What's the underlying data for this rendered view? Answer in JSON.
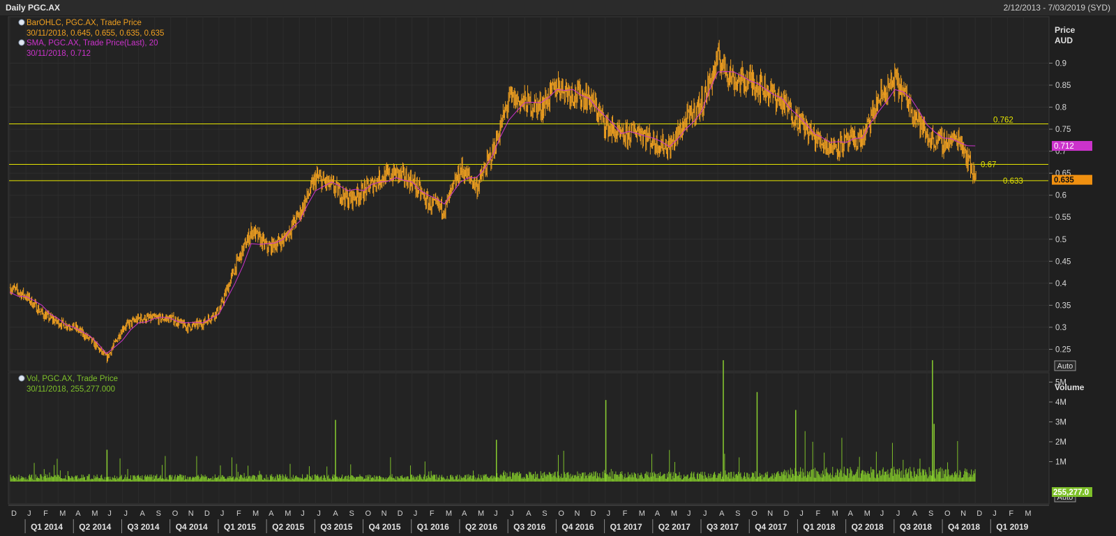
{
  "window": {
    "title": "Daily PGC.AX",
    "date_range": "2/12/2013 - 7/03/2019 (SYD)"
  },
  "colors": {
    "background": "#1f1f1f",
    "grid": "#303030",
    "price": "#f0a020",
    "sma": "#cc33cc",
    "volume": "#7ec02a",
    "level_line": "#e6e600",
    "axis_text": "#d8d8d8"
  },
  "price_panel": {
    "legend": [
      {
        "icon": "eye-icon",
        "text": "BarOHLC, PGC.AX, Trade Price",
        "color": "#f0a020"
      },
      {
        "icon": "",
        "text": "30/11/2018, 0.645, 0.655, 0.635, 0.635",
        "color": "#f0a020"
      },
      {
        "icon": "eye-icon",
        "text": "SMA, PGC.AX, Trade Price(Last),  20",
        "color": "#cc33cc"
      },
      {
        "icon": "",
        "text": "30/11/2018, 0.712",
        "color": "#cc33cc"
      }
    ],
    "axis_title": "Price",
    "axis_unit": "AUD",
    "auto_label": "Auto",
    "sma_tag": "0.712",
    "last_tag": "0.635",
    "level_labels": [
      "0.762",
      "0.67",
      "0.633"
    ]
  },
  "volume_panel": {
    "legend": [
      {
        "icon": "eye-icon",
        "text": "Vol, PGC.AX, Trade Price",
        "color": "#7ec02a"
      },
      {
        "icon": "",
        "text": "30/11/2018, 255,277.000",
        "color": "#7ec02a"
      }
    ],
    "axis_title": "Volume",
    "auto_label": "Auto",
    "last_tag": "255,277.0"
  },
  "chart_data": {
    "type": "line",
    "title": "Daily PGC.AX",
    "series_ohlc": "BarOHLC, PGC.AX, Trade Price",
    "series_sma": "SMA, PGC.AX, Trade Price(Last),  20",
    "series_volume": "Vol, PGC.AX, Trade Price",
    "ylabel": "Price AUD",
    "ylim": [
      0.2,
      0.98
    ],
    "yticks": [
      "0.25",
      "0.3",
      "0.35",
      "0.4",
      "0.45",
      "0.5",
      "0.55",
      "0.6",
      "0.65",
      "0.7",
      "0.75",
      "0.8",
      "0.85",
      "0.9"
    ],
    "volume_ylim": [
      0,
      6000000
    ],
    "volume_ticks": [
      "1M",
      "2M",
      "3M",
      "4M",
      "5M"
    ],
    "horizontal_levels": [
      0.762,
      0.67,
      0.633
    ],
    "last_bar": {
      "date": "30/11/2018",
      "open": 0.645,
      "high": 0.655,
      "low": 0.635,
      "close": 0.635
    },
    "last_sma": 0.712,
    "last_volume": 255277,
    "month_labels": [
      "D",
      "J",
      "F",
      "M",
      "A",
      "M",
      "J",
      "J",
      "A",
      "S",
      "O",
      "N",
      "D",
      "J",
      "F",
      "M",
      "A",
      "M",
      "J",
      "J",
      "A",
      "S",
      "O",
      "N",
      "D",
      "J",
      "F",
      "M",
      "A",
      "M",
      "J",
      "J",
      "A",
      "S",
      "O",
      "N",
      "D",
      "J",
      "F",
      "M",
      "A",
      "M",
      "J",
      "J",
      "A",
      "S",
      "O",
      "N",
      "D",
      "J",
      "F",
      "M",
      "A",
      "M",
      "J",
      "J",
      "A",
      "S",
      "O",
      "N",
      "D",
      "J",
      "F",
      "M"
    ],
    "quarter_labels": [
      "Q1 2014",
      "Q2 2014",
      "Q3 2014",
      "Q4 2014",
      "Q1 2015",
      "Q2 2015",
      "Q3 2015",
      "Q4 2015",
      "Q1 2016",
      "Q2 2016",
      "Q3 2016",
      "Q4 2016",
      "Q1 2017",
      "Q2 2017",
      "Q3 2017",
      "Q4 2017",
      "Q1 2018",
      "Q2 2018",
      "Q3 2018",
      "Q4 2018",
      "Q1 2019"
    ],
    "close_monthly": [
      0.39,
      0.37,
      0.33,
      0.31,
      0.3,
      0.27,
      0.23,
      0.3,
      0.32,
      0.32,
      0.32,
      0.3,
      0.31,
      0.34,
      0.44,
      0.52,
      0.48,
      0.5,
      0.56,
      0.64,
      0.62,
      0.59,
      0.61,
      0.64,
      0.65,
      0.63,
      0.58,
      0.57,
      0.66,
      0.62,
      0.7,
      0.82,
      0.81,
      0.8,
      0.85,
      0.83,
      0.82,
      0.76,
      0.73,
      0.75,
      0.72,
      0.71,
      0.77,
      0.81,
      0.91,
      0.86,
      0.86,
      0.84,
      0.81,
      0.77,
      0.73,
      0.71,
      0.72,
      0.73,
      0.82,
      0.86,
      0.8,
      0.73,
      0.72,
      0.73,
      0.635
    ],
    "sma_monthly": [
      0.38,
      0.37,
      0.35,
      0.32,
      0.3,
      0.28,
      0.24,
      0.27,
      0.31,
      0.32,
      0.32,
      0.31,
      0.31,
      0.33,
      0.4,
      0.49,
      0.49,
      0.5,
      0.54,
      0.61,
      0.63,
      0.61,
      0.61,
      0.63,
      0.64,
      0.63,
      0.6,
      0.58,
      0.63,
      0.64,
      0.69,
      0.77,
      0.81,
      0.81,
      0.84,
      0.84,
      0.82,
      0.78,
      0.74,
      0.74,
      0.73,
      0.71,
      0.75,
      0.79,
      0.88,
      0.88,
      0.86,
      0.84,
      0.82,
      0.78,
      0.74,
      0.72,
      0.72,
      0.73,
      0.79,
      0.84,
      0.82,
      0.76,
      0.73,
      0.72,
      0.712
    ],
    "volume_spikes": [
      {
        "month_index": 6.0,
        "value": 1600000
      },
      {
        "month_index": 20.2,
        "value": 3100000
      },
      {
        "month_index": 30.2,
        "value": 2100000
      },
      {
        "month_index": 37.0,
        "value": 4100000
      },
      {
        "month_index": 44.3,
        "value": 6100000
      },
      {
        "month_index": 46.4,
        "value": 4500000
      },
      {
        "month_index": 48.8,
        "value": 3600000
      },
      {
        "month_index": 57.3,
        "value": 6100000
      },
      {
        "month_index": 57.4,
        "value": 2900000
      }
    ],
    "volume_baseline": 250000
  }
}
